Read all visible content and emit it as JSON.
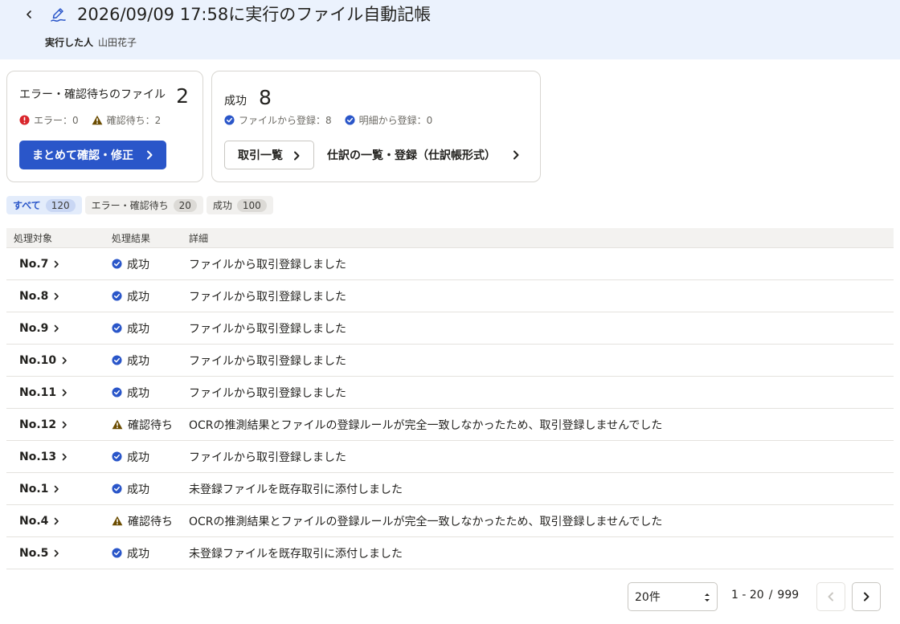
{
  "header": {
    "title": "2026/09/09 17:58に実行のファイル自動記帳",
    "executor_label": "実行した人",
    "executor_name": "山田花子"
  },
  "summary_error": {
    "label": "エラー・確認待ちのファイル",
    "count": "2",
    "error_stat": "エラー：0",
    "pending_stat": "確認待ち：2",
    "button_label": "まとめて確認・修正"
  },
  "summary_success": {
    "label": "成功",
    "count": "8",
    "file_stat": "ファイルから登録：8",
    "detail_stat": "明細から登録：0",
    "deals_button": "取引一覧",
    "journal_button": "仕訳の一覧・登録（仕訳帳形式）"
  },
  "filters": [
    {
      "label": "すべて",
      "count": "120"
    },
    {
      "label": "エラー・確認待ち",
      "count": "20"
    },
    {
      "label": "成功",
      "count": "100"
    }
  ],
  "table": {
    "headers": [
      "処理対象",
      "処理結果",
      "詳細"
    ],
    "rows": [
      {
        "target": "No.7",
        "status": "成功",
        "detail": "ファイルから取引登録しました"
      },
      {
        "target": "No.8",
        "status": "成功",
        "detail": "ファイルから取引登録しました"
      },
      {
        "target": "No.9",
        "status": "成功",
        "detail": "ファイルから取引登録しました"
      },
      {
        "target": "No.10",
        "status": "成功",
        "detail": "ファイルから取引登録しました"
      },
      {
        "target": "No.11",
        "status": "成功",
        "detail": "ファイルから取引登録しました"
      },
      {
        "target": "No.12",
        "status": "確認待ち",
        "detail": "OCRの推測結果とファイルの登録ルールが完全一致しなかったため、取引登録しませんでした"
      },
      {
        "target": "No.13",
        "status": "成功",
        "detail": "ファイルから取引登録しました"
      },
      {
        "target": "No.1",
        "status": "成功",
        "detail": "未登録ファイルを既存取引に添付しました"
      },
      {
        "target": "No.4",
        "status": "確認待ち",
        "detail": "OCRの推測結果とファイルの登録ルールが完全一致しなかったため、取引登録しませんでした"
      },
      {
        "target": "No.5",
        "status": "成功",
        "detail": "未登録ファイルを既存取引に添付しました"
      }
    ]
  },
  "pagination": {
    "per_page": "20件",
    "range": "1 - 20",
    "total": "999"
  },
  "icons": {
    "title": "auto-bookkeeping-icon",
    "success": "check-circle-icon",
    "pending": "warning-triangle-icon",
    "error": "error-circle-icon"
  },
  "colors": {
    "header_bg": "#ebf2fd",
    "primary": "#2a56c9",
    "success": "#2a56c9",
    "warning": "#6b4c00",
    "error": "#d9262c"
  }
}
